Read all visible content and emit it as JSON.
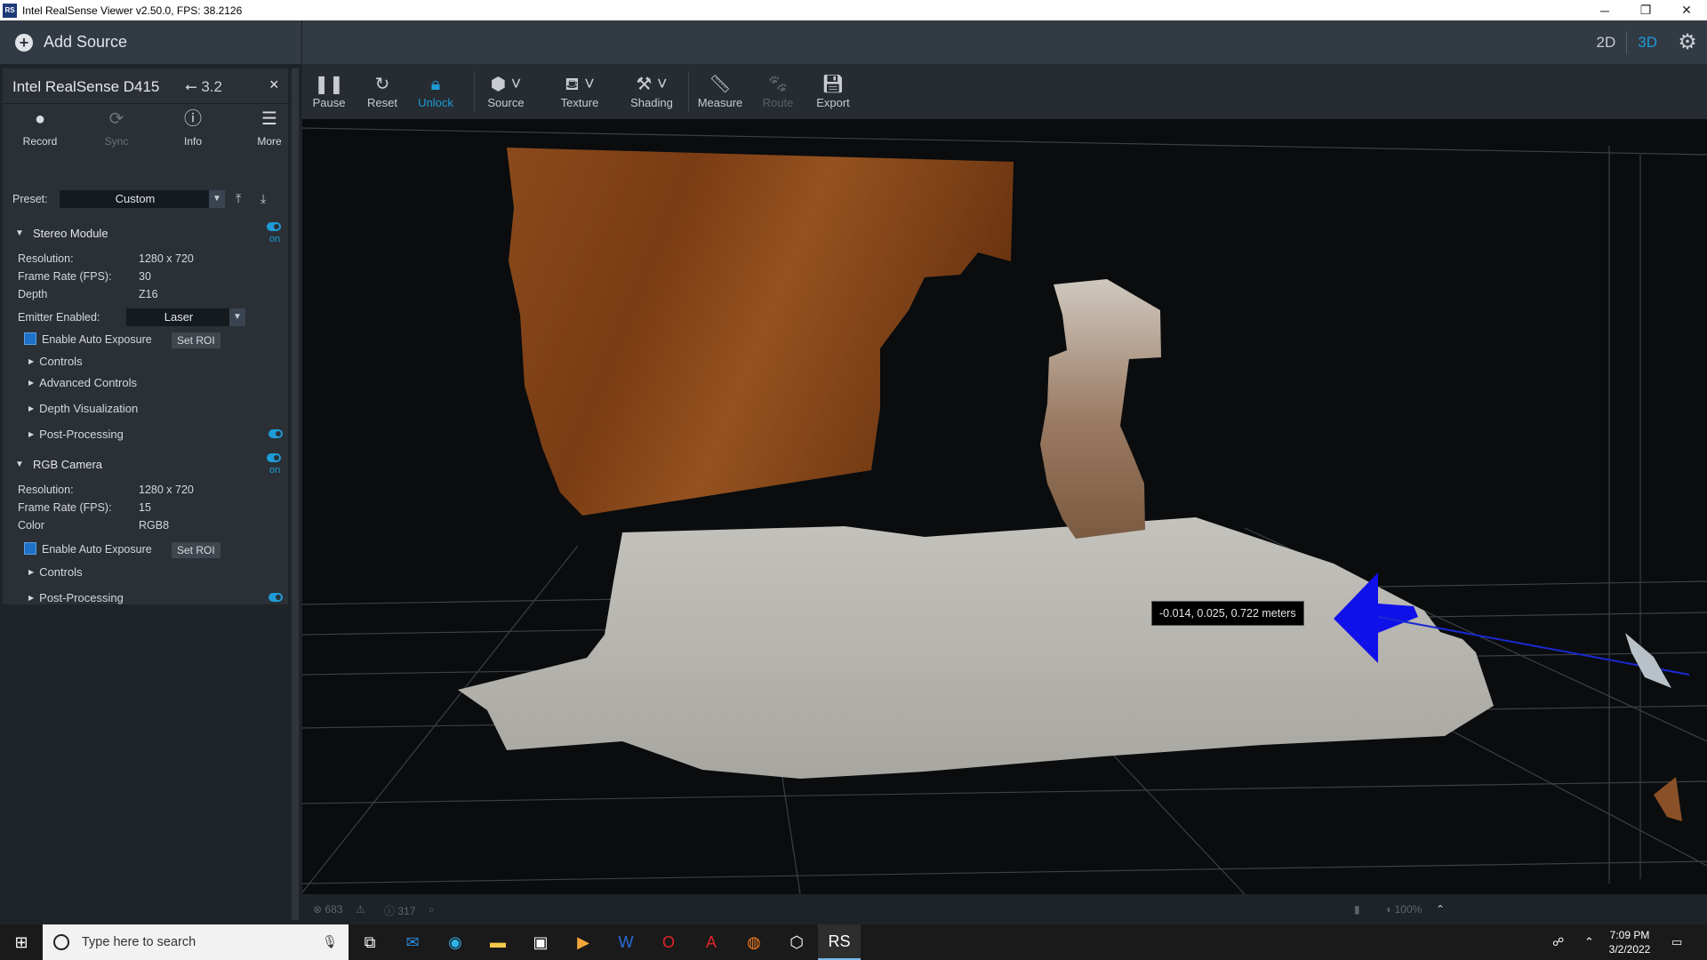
{
  "window": {
    "title": "Intel RealSense Viewer v2.50.0, FPS: 38.2126",
    "app_icon_text": "RS",
    "minimize": "─",
    "restore": "❐",
    "close": "✕"
  },
  "topbar": {
    "add_source": "Add Source",
    "view_2d": "2D",
    "view_3d": "3D",
    "active_view": "3D"
  },
  "device": {
    "name": "Intel RealSense D415",
    "usb": "3.2",
    "close": "×",
    "buttons": [
      {
        "label": "Record",
        "icon": "record-icon",
        "enabled": true
      },
      {
        "label": "Sync",
        "icon": "sync-icon",
        "enabled": false
      },
      {
        "label": "Info",
        "icon": "info-icon",
        "enabled": true
      },
      {
        "label": "More",
        "icon": "menu-icon",
        "enabled": true
      }
    ],
    "preset_label": "Preset:",
    "preset_value": "Custom"
  },
  "stereo": {
    "title": "Stereo Module",
    "on_label": "on",
    "resolution_label": "Resolution:",
    "resolution": "1280 x 720",
    "fps_label": "Frame Rate (FPS):",
    "fps": "30",
    "format_label": "Depth",
    "format": "Z16",
    "emitter_label": "Emitter Enabled:",
    "emitter_value": "Laser",
    "auto_exposure": "Enable Auto Exposure",
    "set_roi": "Set ROI",
    "controls": "Controls",
    "advanced_controls": "Advanced Controls",
    "depth_visualization": "Depth Visualization",
    "post_processing": "Post-Processing"
  },
  "rgb": {
    "title": "RGB Camera",
    "on_label": "on",
    "resolution_label": "Resolution:",
    "resolution": "1280 x 720",
    "fps_label": "Frame Rate (FPS):",
    "fps": "15",
    "format_label": "Color",
    "format": "RGB8",
    "auto_exposure": "Enable Auto Exposure",
    "set_roi": "Set ROI",
    "controls": "Controls",
    "post_processing": "Post-Processing"
  },
  "toolbar": {
    "items": [
      {
        "label": "Pause",
        "icon": "pause-icon",
        "state": "normal"
      },
      {
        "label": "Reset",
        "icon": "reset-icon",
        "state": "normal"
      },
      {
        "label": "Unlock",
        "icon": "lock-icon",
        "state": "active"
      },
      {
        "label": "Source",
        "icon": "cube-icon",
        "state": "normal"
      },
      {
        "label": "Texture",
        "icon": "paint-bucket-icon",
        "state": "normal"
      },
      {
        "label": "Shading",
        "icon": "paint-roller-icon",
        "state": "normal"
      },
      {
        "label": "Measure",
        "icon": "ruler-icon",
        "state": "normal"
      },
      {
        "label": "Route",
        "icon": "paw-icon",
        "state": "disabled"
      },
      {
        "label": "Export",
        "icon": "save-icon",
        "state": "normal"
      }
    ]
  },
  "viewport": {
    "tooltip": "-0.014, 0.025, 0.722 meters"
  },
  "statusbar": {
    "errors": "683",
    "info_count": "317",
    "zoom": "100%"
  },
  "taskbar": {
    "search_placeholder": "Type here to search",
    "time": "7:09 PM",
    "date": "3/2/2022"
  }
}
